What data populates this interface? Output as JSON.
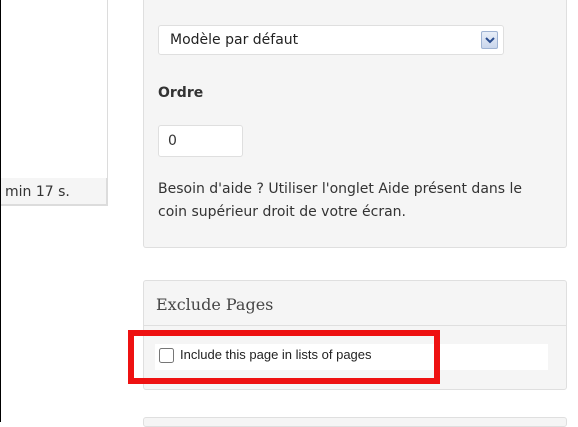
{
  "status": {
    "time_text": "min 17 s."
  },
  "page_attributes": {
    "template_select": {
      "value": "Modèle par défaut",
      "arrow_icon": "chevron-down-icon"
    },
    "order_label": "Ordre",
    "order_value": "0",
    "help_text": "Besoin d'aide ? Utiliser l'onglet Aide présent dans le coin supérieur droit de votre écran."
  },
  "exclude_pages": {
    "title": "Exclude Pages",
    "include_label": "Include this page in lists of pages",
    "include_checked": false
  },
  "colors": {
    "highlight": "#ee1111",
    "panel_bg": "#f5f5f5",
    "border": "#dfdfdf"
  }
}
